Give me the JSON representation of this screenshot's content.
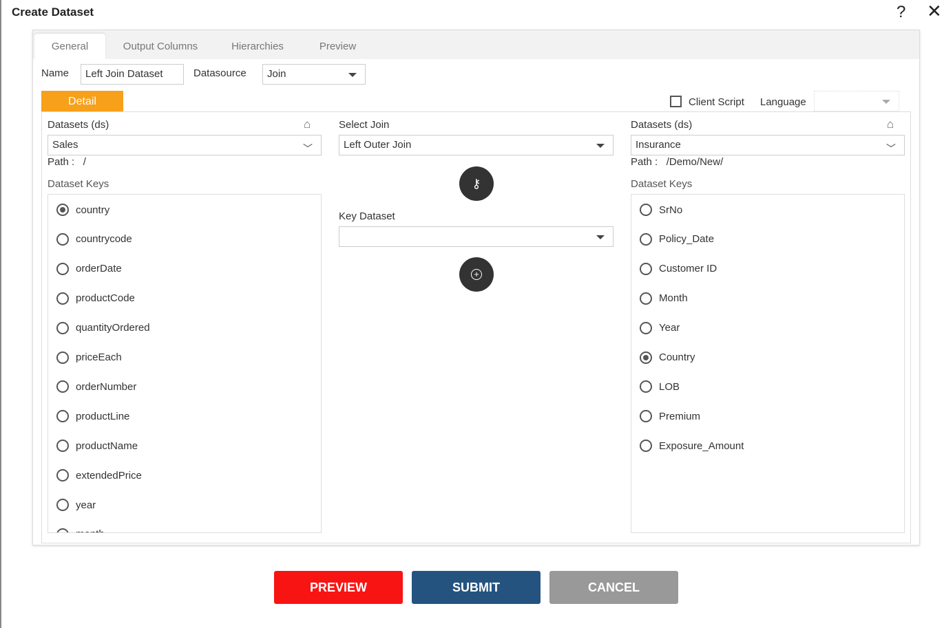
{
  "dialog": {
    "title": "Create Dataset",
    "help_icon": "question-icon",
    "close_icon": "close-icon"
  },
  "tabs": [
    {
      "label": "General",
      "active": true
    },
    {
      "label": "Output Columns"
    },
    {
      "label": "Hierarchies"
    },
    {
      "label": "Preview"
    }
  ],
  "general": {
    "name_label": "Name",
    "name_value": "Left Join Dataset",
    "datasource_label": "Datasource",
    "datasource_value": "Join"
  },
  "detail": {
    "label": "Detail",
    "client_script_label": "Client Script",
    "client_script_checked": false,
    "language_label": "Language",
    "language_value": ""
  },
  "left": {
    "datasets_label": "Datasets (ds)",
    "dataset_value": "Sales",
    "path_label": "Path :",
    "path_value": "/",
    "keys_label": "Dataset Keys",
    "keys": [
      "country",
      "countrycode",
      "orderDate",
      "productCode",
      "quantityOrdered",
      "priceEach",
      "orderNumber",
      "productLine",
      "productName",
      "extendedPrice",
      "year",
      "month"
    ],
    "selected": "country"
  },
  "middle": {
    "select_join_label": "Select Join",
    "select_join_value": "Left Outer Join",
    "key_dataset_label": "Key Dataset",
    "key_dataset_value": ""
  },
  "right": {
    "datasets_label": "Datasets (ds)",
    "dataset_value": "Insurance",
    "path_label": "Path :",
    "path_value": "/Demo/New/",
    "keys_label": "Dataset Keys",
    "keys": [
      "SrNo",
      "Policy_Date",
      "Customer ID",
      "Month",
      "Year",
      "Country",
      "LOB",
      "Premium",
      "Exposure_Amount"
    ],
    "selected": "Country"
  },
  "buttons": {
    "preview": "PREVIEW",
    "submit": "SUBMIT",
    "cancel": "CANCEL"
  },
  "colors": {
    "detail_tab": "#f7a01a",
    "preview": "#f91414",
    "submit": "#245380",
    "cancel": "#999999"
  }
}
